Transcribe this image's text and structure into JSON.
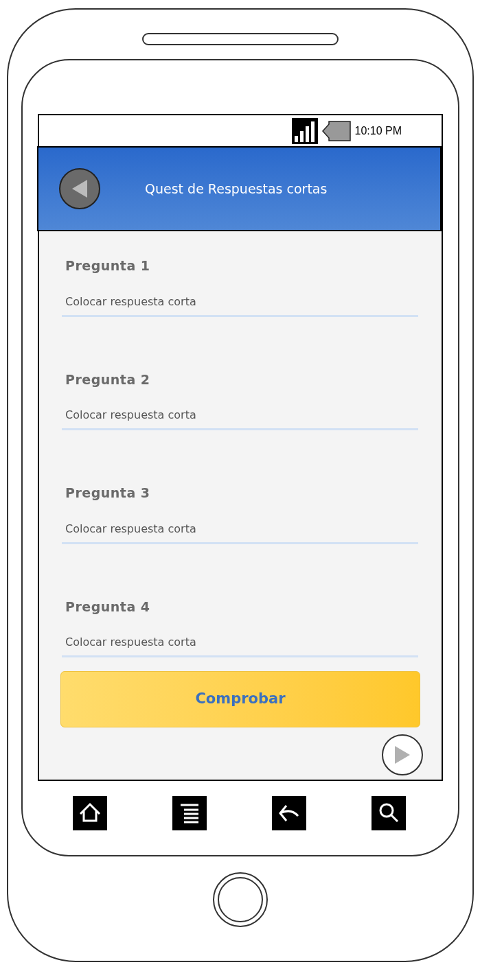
{
  "status_bar": {
    "time": "10:10 PM"
  },
  "header": {
    "title": "Quest de Respuestas cortas"
  },
  "questions": [
    {
      "label": "Pregunta 1",
      "placeholder": "Colocar respuesta corta"
    },
    {
      "label": "Pregunta 2",
      "placeholder": "Colocar respuesta corta"
    },
    {
      "label": "Pregunta 3",
      "placeholder": "Colocar respuesta corta"
    },
    {
      "label": "Pregunta 4",
      "placeholder": "Colocar respuesta corta"
    }
  ],
  "submit_button": {
    "label": "Comprobar"
  }
}
